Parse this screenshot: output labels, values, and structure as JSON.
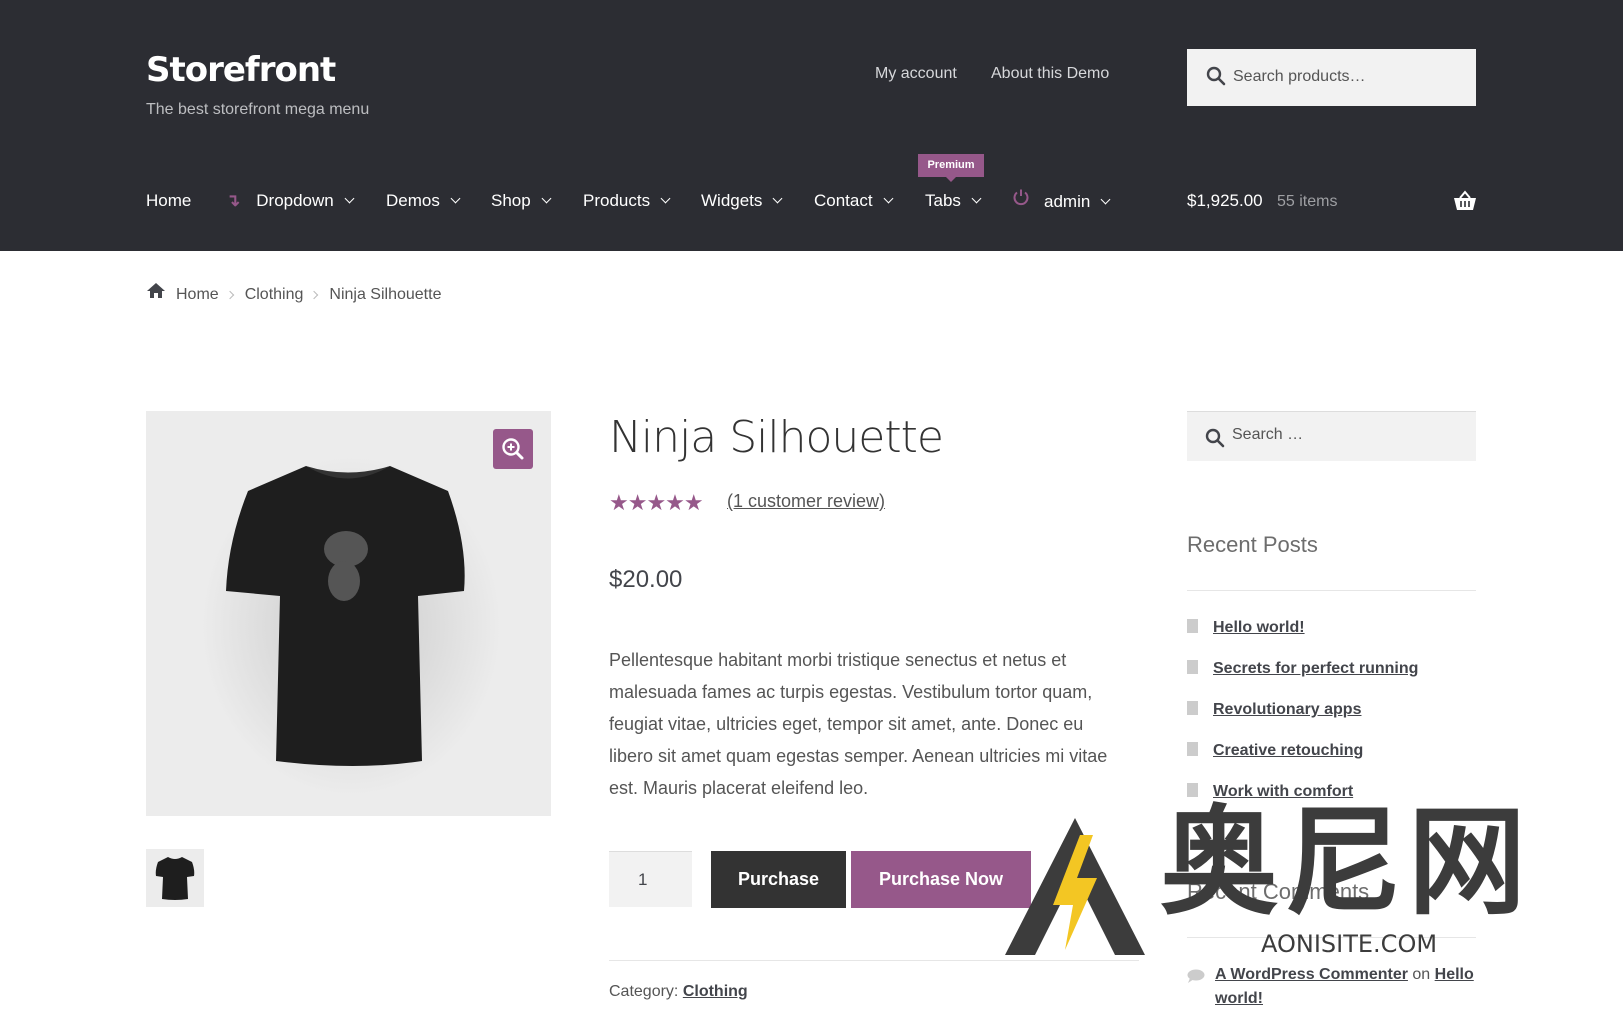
{
  "header": {
    "site_title": "Storefront",
    "tagline": "The best storefront mega menu",
    "top_links": [
      "My account",
      "About this Demo"
    ],
    "search_placeholder": "Search products…"
  },
  "nav": {
    "items": [
      "Home",
      "Dropdown",
      "Demos",
      "Shop",
      "Products",
      "Widgets",
      "Contact",
      "Tabs",
      "admin"
    ],
    "premium_badge": "Premium"
  },
  "cart": {
    "total": "$1,925.00",
    "count": "55 items"
  },
  "breadcrumb": [
    "Home",
    "Clothing",
    "Ninja Silhouette"
  ],
  "product": {
    "title": "Ninja Silhouette",
    "rating": 5,
    "stars": "★★★★★",
    "review_link": "(1 customer review)",
    "price": "$20.00",
    "description": "Pellentesque habitant morbi tristique senectus et netus et malesuada fames ac turpis egestas. Vestibulum tortor quam, feugiat vitae, ultricies eget, tempor sit amet, ante. Donec eu libero sit amet quam egestas semper. Aenean ultricies mi vitae est. Mauris placerat eleifend leo.",
    "quantity": "1",
    "purchase_label": "Purchase",
    "purchase_now_label": "Purchase Now",
    "category_label": "Category:",
    "category_value": "Clothing"
  },
  "sidebar": {
    "search_placeholder": "Search …",
    "recent_posts_title": "Recent Posts",
    "recent_posts": [
      "Hello world!",
      "Secrets for perfect running",
      "Revolutionary apps",
      "Creative retouching",
      "Work with comfort"
    ],
    "recent_comments_title": "Recent Comments",
    "comment": {
      "author": "A WordPress Commenter",
      "on": "on",
      "post_line1": "Hello",
      "post_line2": "world!"
    }
  },
  "watermark": {
    "cn": "奥尼网",
    "en": "AONISITE.COM"
  },
  "colors": {
    "header_bg": "#2c2d33",
    "accent": "#96588a",
    "dark_button": "#333333"
  }
}
